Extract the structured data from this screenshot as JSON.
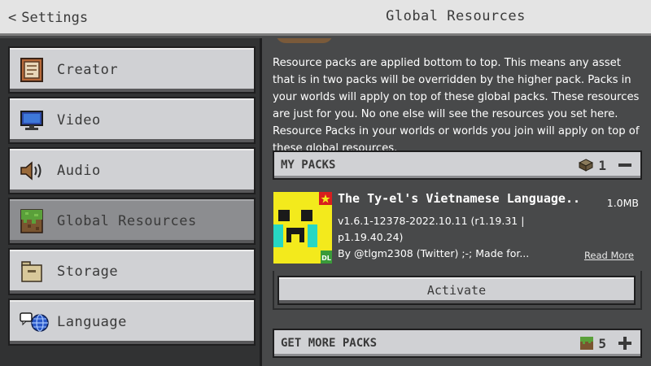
{
  "header": {
    "back_label": "Settings",
    "title": "Global Resources"
  },
  "sidebar": {
    "items": [
      {
        "label": "Creator",
        "icon": "creator-icon",
        "selected": false
      },
      {
        "label": "Video",
        "icon": "monitor-icon",
        "selected": false
      },
      {
        "label": "Audio",
        "icon": "speaker-icon",
        "selected": false
      },
      {
        "label": "Global Resources",
        "icon": "grass-block-icon",
        "selected": true
      },
      {
        "label": "Storage",
        "icon": "storage-icon",
        "selected": false
      },
      {
        "label": "Language",
        "icon": "globe-icon",
        "selected": false
      }
    ]
  },
  "main": {
    "description": "Resource packs are applied bottom to top. This means any asset that is in two packs will be overridden by the higher pack. Packs in your worlds will apply on top of these global packs. These resources are just for you. No one else will see the resources you set here. Resource Packs in your worlds or worlds you join will apply on top of these global resources.",
    "my_packs": {
      "title": "MY PACKS",
      "count": "1",
      "toggle": "collapse"
    },
    "pack": {
      "name": "The Ty-el's Vietnamese Language...",
      "size": "1.0MB",
      "version": "v1.6.1-12378-2022.10.11 (r1.19.31 | p1.19.40.24)",
      "author": "By @tlgm2308 (Twitter) ;-; Made for...",
      "read_more": "Read More",
      "activate_label": "Activate",
      "badge": "DL"
    },
    "get_more_packs": {
      "title": "GET MORE PACKS",
      "count": "5",
      "toggle": "expand"
    }
  },
  "colors": {
    "panel_light": "#d0d1d4",
    "panel_selected": "#8c8d90",
    "background_dark": "#48494a",
    "sidebar_bg": "#313233",
    "pack_icon_yellow": "#f3ea1c",
    "pack_icon_cyan": "#27d7c3"
  }
}
